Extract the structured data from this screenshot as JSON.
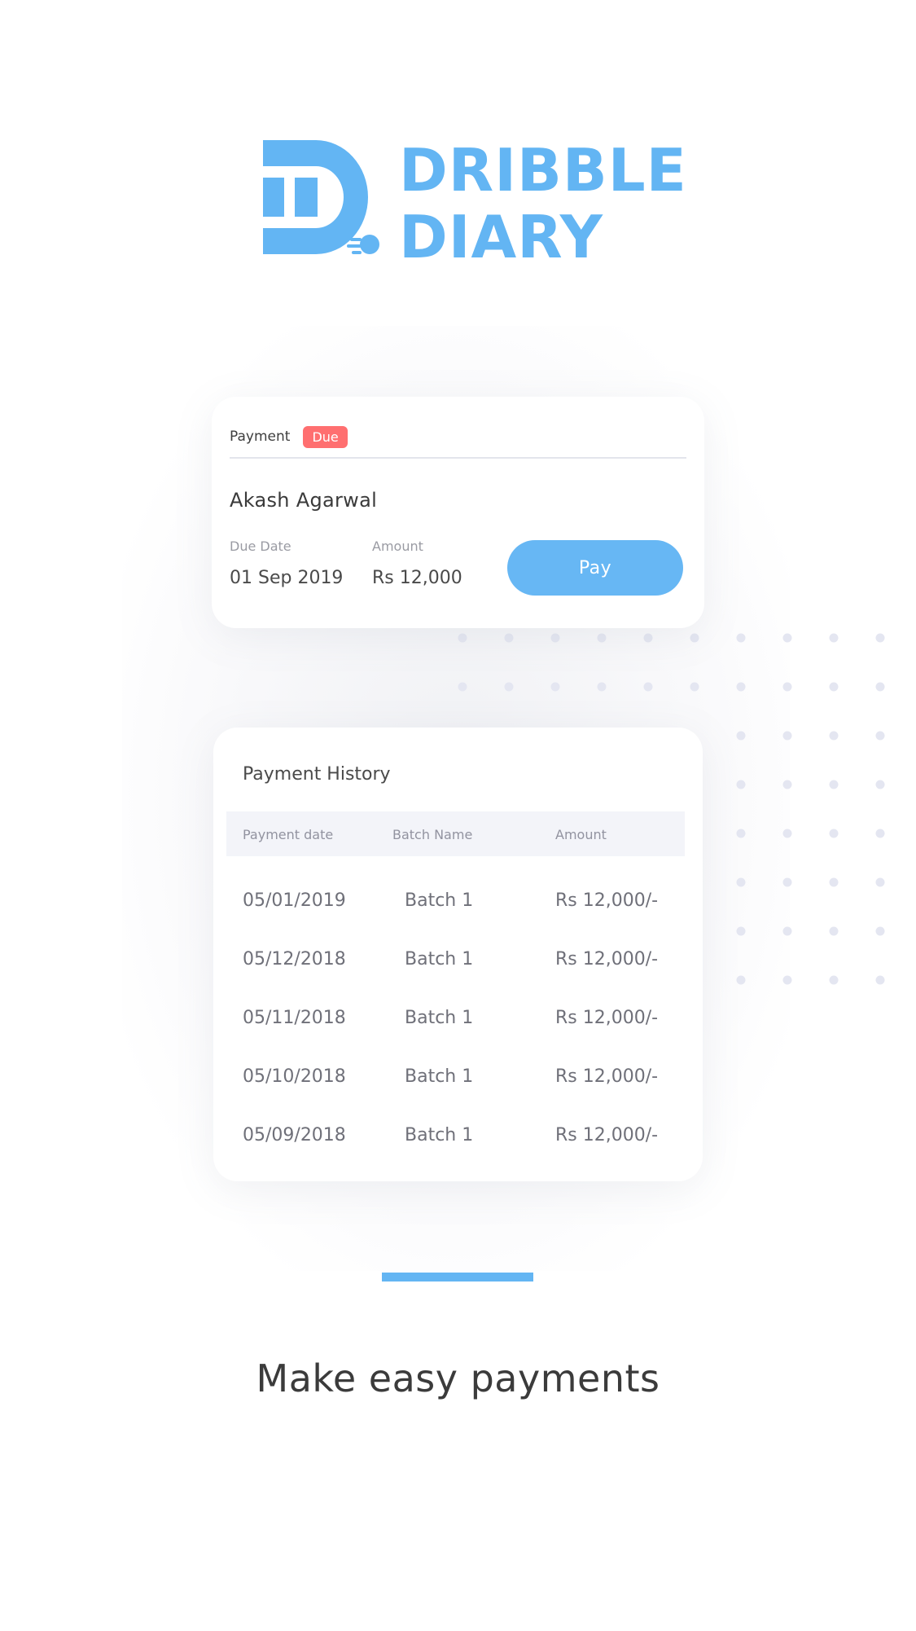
{
  "brand": {
    "line1": "DRIBBLE",
    "line2": "DIARY",
    "color": "#63b5f3"
  },
  "payment_card": {
    "label": "Payment",
    "badge": "Due",
    "badge_color": "#ff6f70",
    "payer_name": "Akash Agarwal",
    "due_date_label": "Due Date",
    "due_date_value": "01 Sep 2019",
    "amount_label": "Amount",
    "amount_value": "Rs 12,000",
    "pay_button": "Pay"
  },
  "history": {
    "title": "Payment History",
    "columns": [
      "Payment date",
      "Batch Name",
      "Amount"
    ],
    "rows": [
      [
        "05/01/2019",
        "Batch 1",
        "Rs 12,000/-"
      ],
      [
        "05/12/2018",
        "Batch 1",
        "Rs 12,000/-"
      ],
      [
        "05/11/2018",
        "Batch 1",
        "Rs 12,000/-"
      ],
      [
        "05/10/2018",
        "Batch 1",
        "Rs 12,000/-"
      ],
      [
        "05/09/2018",
        "Batch 1",
        "Rs 12,000/-"
      ]
    ]
  },
  "tagline": "Make easy payments"
}
